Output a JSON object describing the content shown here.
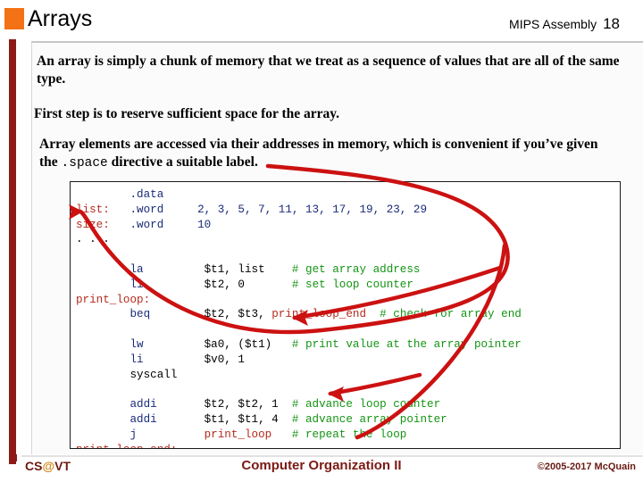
{
  "header": {
    "title": "Arrays",
    "course": "MIPS Assembly",
    "slide_number": "18",
    "bullet_color": "#F47216"
  },
  "body": {
    "paragraph1": "An array is simply a chunk of memory that we treat as a sequence of values that are all of the same type.",
    "paragraph2": "First step is to reserve sufficient space for the array.",
    "paragraph3_part1": "Array elements are accessed via their addresses in memory, which is convenient if you’ve given the ",
    "paragraph3_mono": ".space",
    "paragraph3_part2": " directive a suitable label."
  },
  "code": {
    "language": "MIPS Assembly",
    "colors": {
      "directive": "#1A2A7A",
      "label": "#B42B1E",
      "instruction": "#1A2A7A",
      "comment": "#149414",
      "plain": "#000000"
    },
    "lines": [
      [
        {
          "t": "        ",
          "c": "plain"
        },
        {
          "t": ".data",
          "c": "directive"
        }
      ],
      [
        {
          "t": "list:",
          "c": "label"
        },
        {
          "t": "   ",
          "c": "plain"
        },
        {
          "t": ".word",
          "c": "directive"
        },
        {
          "t": "     ",
          "c": "plain"
        },
        {
          "t": "2, 3, 5, 7, 11, 13, 17, 19, 23, 29",
          "c": "directive"
        }
      ],
      [
        {
          "t": "size:",
          "c": "label"
        },
        {
          "t": "   ",
          "c": "plain"
        },
        {
          "t": ".word",
          "c": "directive"
        },
        {
          "t": "     ",
          "c": "plain"
        },
        {
          "t": "10",
          "c": "directive"
        }
      ],
      [
        {
          "t": ". . .",
          "c": "plain"
        }
      ],
      [
        {
          "t": "",
          "c": "plain"
        }
      ],
      [
        {
          "t": "        ",
          "c": "plain"
        },
        {
          "t": "la",
          "c": "instruction"
        },
        {
          "t": "         ",
          "c": "plain"
        },
        {
          "t": "$t1, list",
          "c": "plain"
        },
        {
          "t": "    ",
          "c": "plain"
        },
        {
          "t": "# get array address",
          "c": "comment"
        }
      ],
      [
        {
          "t": "        ",
          "c": "plain"
        },
        {
          "t": "li",
          "c": "instruction"
        },
        {
          "t": "         ",
          "c": "plain"
        },
        {
          "t": "$t2, 0",
          "c": "plain"
        },
        {
          "t": "       ",
          "c": "plain"
        },
        {
          "t": "# set loop counter",
          "c": "comment"
        }
      ],
      [
        {
          "t": "print_loop:",
          "c": "label"
        }
      ],
      [
        {
          "t": "        ",
          "c": "plain"
        },
        {
          "t": "beq",
          "c": "instruction"
        },
        {
          "t": "        ",
          "c": "plain"
        },
        {
          "t": "$t2, $t3, ",
          "c": "plain"
        },
        {
          "t": "print_loop_end",
          "c": "label"
        },
        {
          "t": "  ",
          "c": "plain"
        },
        {
          "t": "# check for array end",
          "c": "comment"
        }
      ],
      [
        {
          "t": "",
          "c": "plain"
        }
      ],
      [
        {
          "t": "        ",
          "c": "plain"
        },
        {
          "t": "lw",
          "c": "instruction"
        },
        {
          "t": "         ",
          "c": "plain"
        },
        {
          "t": "$a0, ($t1)",
          "c": "plain"
        },
        {
          "t": "   ",
          "c": "plain"
        },
        {
          "t": "# print value at the array pointer",
          "c": "comment"
        }
      ],
      [
        {
          "t": "        ",
          "c": "plain"
        },
        {
          "t": "li",
          "c": "instruction"
        },
        {
          "t": "         ",
          "c": "plain"
        },
        {
          "t": "$v0, 1",
          "c": "plain"
        }
      ],
      [
        {
          "t": "        ",
          "c": "plain"
        },
        {
          "t": "syscall",
          "c": "plain"
        }
      ],
      [
        {
          "t": "",
          "c": "plain"
        }
      ],
      [
        {
          "t": "        ",
          "c": "plain"
        },
        {
          "t": "addi",
          "c": "instruction"
        },
        {
          "t": "       ",
          "c": "plain"
        },
        {
          "t": "$t2, $t2, 1",
          "c": "plain"
        },
        {
          "t": "  ",
          "c": "plain"
        },
        {
          "t": "# advance loop counter",
          "c": "comment"
        }
      ],
      [
        {
          "t": "        ",
          "c": "plain"
        },
        {
          "t": "addi",
          "c": "instruction"
        },
        {
          "t": "       ",
          "c": "plain"
        },
        {
          "t": "$t1, $t1, 4",
          "c": "plain"
        },
        {
          "t": "  ",
          "c": "plain"
        },
        {
          "t": "# advance array pointer",
          "c": "comment"
        }
      ],
      [
        {
          "t": "        ",
          "c": "plain"
        },
        {
          "t": "j",
          "c": "instruction"
        },
        {
          "t": "          ",
          "c": "plain"
        },
        {
          "t": "print_loop",
          "c": "label"
        },
        {
          "t": "   ",
          "c": "plain"
        },
        {
          "t": "# repeat the loop",
          "c": "comment"
        }
      ],
      [
        {
          "t": "print_loop_end:",
          "c": "label"
        }
      ]
    ]
  },
  "annotation": {
    "color": "#CC1111",
    "description": "red curved arrows from the .space text to the list label and to the lw instruction"
  },
  "footer": {
    "left_prefix": "CS",
    "left_at": "@",
    "left_suffix": "VT",
    "center": "Computer Organization II",
    "right": "©2005-2017 McQuain"
  }
}
